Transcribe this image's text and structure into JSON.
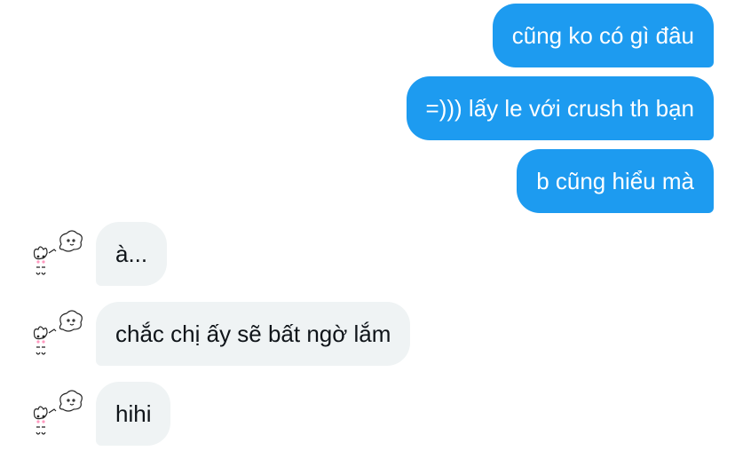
{
  "conversation": {
    "outgoing": [
      {
        "text": "cũng ko có gì đâu"
      },
      {
        "text": "=))) lấy le với crush th bạn"
      },
      {
        "text": "b cũng hiểu mà"
      }
    ],
    "incoming": [
      {
        "text": "à..."
      },
      {
        "text": "chắc chị ấy sẽ bất ngờ lắm"
      },
      {
        "text": "hihi"
      }
    ]
  },
  "colors": {
    "outgoing_bubble": "#1d9bf0",
    "incoming_bubble": "#eff3f4",
    "outgoing_text": "#ffffff",
    "incoming_text": "#0f1419"
  },
  "avatar": {
    "icon": "doodle-bunny-avatar-icon"
  }
}
